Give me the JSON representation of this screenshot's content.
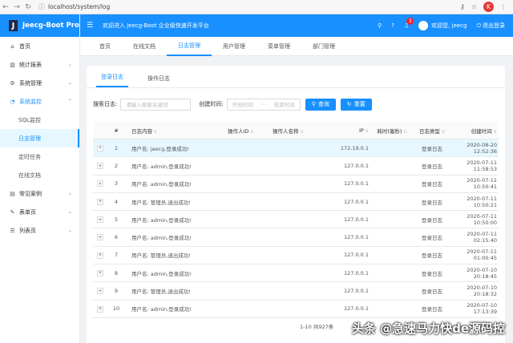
{
  "browser": {
    "url": "localhost/system/log",
    "profile_initial": "K"
  },
  "sidebar": {
    "logo_letter": "J",
    "app_name": "Jeecg-Boot Pro",
    "items": [
      {
        "label": "首页",
        "icon": "home-icon",
        "glyph": "⌂"
      },
      {
        "label": "统计报表",
        "icon": "chart-icon",
        "glyph": "▥",
        "chevron": "⌄"
      },
      {
        "label": "系统管理",
        "icon": "gear-icon",
        "glyph": "⚙",
        "chevron": "⌄"
      },
      {
        "label": "系统监控",
        "icon": "monitor-icon",
        "glyph": "◔",
        "chevron": "⌃"
      }
    ],
    "submenu": [
      {
        "label": "SQL监控"
      },
      {
        "label": "日志管理"
      },
      {
        "label": "定时任务"
      },
      {
        "label": "在线文档"
      }
    ],
    "items_after": [
      {
        "label": "常见案例",
        "icon": "folder-icon",
        "glyph": "▤",
        "chevron": "⌄"
      },
      {
        "label": "表单页",
        "icon": "form-icon",
        "glyph": "✎",
        "chevron": "⌄"
      },
      {
        "label": "列表页",
        "icon": "list-icon",
        "glyph": "☰",
        "chevron": "⌄"
      }
    ]
  },
  "header": {
    "welcome": "欢迎进入 Jeecg-Boot 企业级快速开发平台",
    "notification_count": "3",
    "user_greeting": "欢迎您, jeecg",
    "logout": "退出登录"
  },
  "tabs": [
    "首页",
    "在线文档",
    "日志管理",
    "用户管理",
    "菜单管理",
    "部门管理"
  ],
  "subtabs": [
    "登录日志",
    "操作日志"
  ],
  "search": {
    "label": "搜索日志:",
    "placeholder": "请输入搜索关键词",
    "time_label": "创建时间:",
    "start_placeholder": "开始时间",
    "end_placeholder": "结束时间",
    "range_sep": "~",
    "query": "查询",
    "reset": "重置"
  },
  "table": {
    "headers": [
      "#",
      "日志内容",
      "操作人ID",
      "操作人名称",
      "IP",
      "耗时(毫秒)",
      "日志类型",
      "创建时间"
    ],
    "rows": [
      {
        "num": "1",
        "content": "用户名: jeecg,登录成功!",
        "ip": "172.19.0.1",
        "type": "登录日志",
        "time": "2020-08-20 12:52:36"
      },
      {
        "num": "2",
        "content": "用户名: admin,登录成功!",
        "ip": "127.0.0.1",
        "type": "登录日志",
        "time": "2020-07-11 11:58:53"
      },
      {
        "num": "3",
        "content": "用户名: admin,登录成功!",
        "ip": "127.0.0.1",
        "type": "登录日志",
        "time": "2020-07-11 10:50:41"
      },
      {
        "num": "4",
        "content": "用户名: 管理员,退出成功!",
        "ip": "127.0.0.1",
        "type": "登录日志",
        "time": "2020-07-11 10:50:21"
      },
      {
        "num": "5",
        "content": "用户名: admin,登录成功!",
        "ip": "127.0.0.1",
        "type": "登录日志",
        "time": "2020-07-11 10:50:00"
      },
      {
        "num": "6",
        "content": "用户名: admin,登录成功!",
        "ip": "127.0.0.1",
        "type": "登录日志",
        "time": "2020-07-11 02:15:40"
      },
      {
        "num": "7",
        "content": "用户名: 管理员,退出成功!",
        "ip": "127.0.0.1",
        "type": "登录日志",
        "time": "2020-07-11 01:00:45"
      },
      {
        "num": "8",
        "content": "用户名: admin,登录成功!",
        "ip": "127.0.0.1",
        "type": "登录日志",
        "time": "2020-07-10 20:18:45"
      },
      {
        "num": "9",
        "content": "用户名: 管理员,退出成功!",
        "ip": "127.0.0.1",
        "type": "登录日志",
        "time": "2020-07-10 20:18:32"
      },
      {
        "num": "10",
        "content": "用户名: admin,登录成功!",
        "ip": "127.0.0.1",
        "type": "登录日志",
        "time": "2020-07-10 17:13:39"
      }
    ]
  },
  "pagination": "1-10 共927条",
  "watermark": "头条 @急速马力快de源码控"
}
